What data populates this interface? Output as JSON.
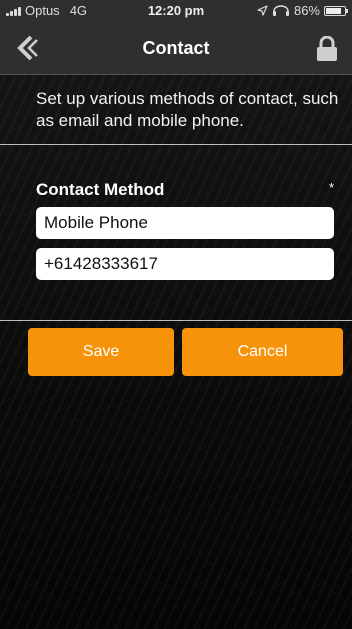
{
  "status_bar": {
    "carrier": "Optus",
    "network": "4G",
    "time": "12:20 pm",
    "battery": "86%",
    "battery_level": 0.86
  },
  "nav": {
    "title": "Contact",
    "back_icon": "chevron-left-double-icon",
    "lock_icon": "lock-icon"
  },
  "intro_text": "Set up various methods of contact, such as email and mobile phone.",
  "form": {
    "section_label": "Contact Method",
    "required_mark": "*",
    "method_value": "Mobile Phone",
    "contact_value": "+61428333617"
  },
  "actions": {
    "save_label": "Save",
    "cancel_label": "Cancel"
  },
  "colors": {
    "accent": "#f7930a",
    "bar": "#2f2f2f"
  }
}
